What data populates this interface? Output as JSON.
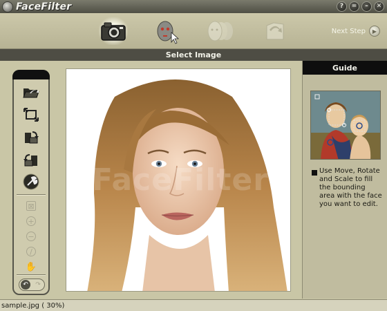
{
  "app": {
    "title": "FaceFilter"
  },
  "window_controls": [
    {
      "name": "help-button",
      "glyph": "?"
    },
    {
      "name": "options-button",
      "glyph": "="
    },
    {
      "name": "minimize-button",
      "glyph": "–"
    },
    {
      "name": "close-button",
      "glyph": "✕"
    }
  ],
  "toolbar": {
    "steps": [
      {
        "name": "select-image",
        "icon": "camera-icon",
        "active": true
      },
      {
        "name": "face-detection",
        "icon": "face-cursor-icon",
        "active": false
      },
      {
        "name": "edit-faces",
        "icon": "faces-icon",
        "active": false
      },
      {
        "name": "save",
        "icon": "folder-arrow-icon",
        "active": false
      }
    ],
    "next_label": "Next Step",
    "next_icon": "arrow-right-icon"
  },
  "header": {
    "title": "Select Image"
  },
  "tools": {
    "main": [
      "open-file-icon",
      "crop-icon",
      "rotate-right-icon",
      "rotate-left-icon",
      "tools-icon"
    ],
    "small": [
      "fit-icon",
      "zoom-in-icon",
      "zoom-out-icon",
      "no-icon",
      "hand-icon"
    ],
    "nav": [
      "undo-icon",
      "redo-icon"
    ]
  },
  "canvas": {
    "watermark": "FaceFilter"
  },
  "guide": {
    "title": "Guide",
    "text": "Use Move, Rotate and Scale to fill the bounding area with the face you want to edit."
  },
  "status": {
    "text": "sample.jpg ( 30%)"
  },
  "colors": {
    "accent_dark": "#4e4d44",
    "panel": "#c9c6a6",
    "guide_header": "#0e0e0e"
  }
}
